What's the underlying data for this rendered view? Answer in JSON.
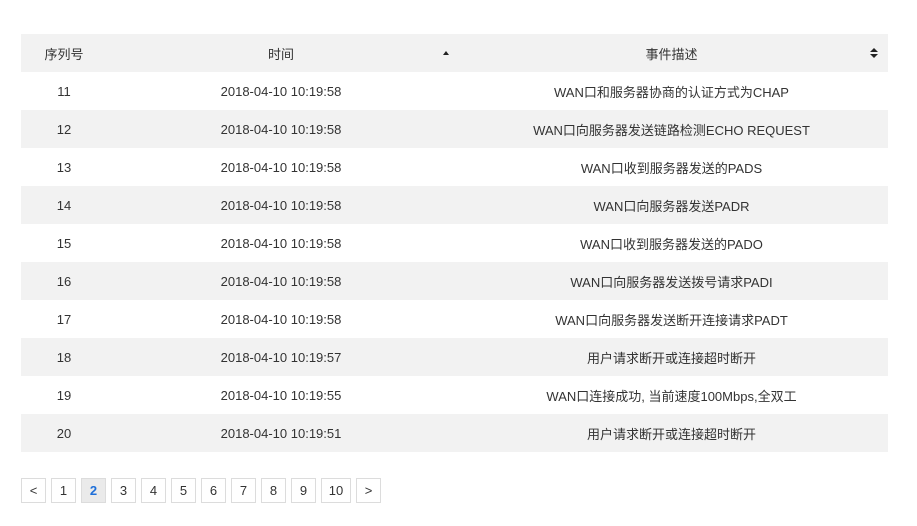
{
  "table": {
    "headers": {
      "index": "序列号",
      "time": "时间",
      "description": "事件描述"
    },
    "rows": [
      {
        "index": "11",
        "time": "2018-04-10 10:19:58",
        "description": "WAN口和服务器协商的认证方式为CHAP"
      },
      {
        "index": "12",
        "time": "2018-04-10 10:19:58",
        "description": "WAN口向服务器发送链路检测ECHO REQUEST"
      },
      {
        "index": "13",
        "time": "2018-04-10 10:19:58",
        "description": "WAN口收到服务器发送的PADS"
      },
      {
        "index": "14",
        "time": "2018-04-10 10:19:58",
        "description": "WAN口向服务器发送PADR"
      },
      {
        "index": "15",
        "time": "2018-04-10 10:19:58",
        "description": "WAN口收到服务器发送的PADO"
      },
      {
        "index": "16",
        "time": "2018-04-10 10:19:58",
        "description": "WAN口向服务器发送拨号请求PADI"
      },
      {
        "index": "17",
        "time": "2018-04-10 10:19:58",
        "description": "WAN口向服务器发送断开连接请求PADT"
      },
      {
        "index": "18",
        "time": "2018-04-10 10:19:57",
        "description": "用户请求断开或连接超时断开"
      },
      {
        "index": "19",
        "time": "2018-04-10 10:19:55",
        "description": "WAN口连接成功, 当前速度100Mbps,全双工"
      },
      {
        "index": "20",
        "time": "2018-04-10 10:19:51",
        "description": "用户请求断开或连接超时断开"
      }
    ]
  },
  "pagination": {
    "prev": "<",
    "next": ">",
    "pages": [
      "1",
      "2",
      "3",
      "4",
      "5",
      "6",
      "7",
      "8",
      "9",
      "10"
    ],
    "current": "2"
  },
  "colors": {
    "stripe": "#f2f2f2",
    "active_page": "#1e6fd9"
  }
}
